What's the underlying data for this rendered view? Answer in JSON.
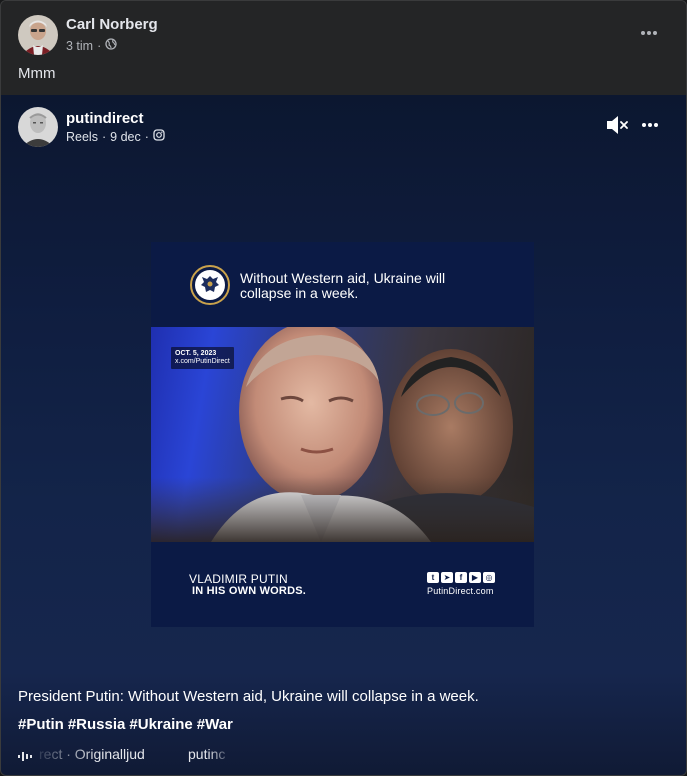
{
  "post": {
    "author": "Carl Norberg",
    "time": "3 tim",
    "separator": "·",
    "audience_icon": "globe-icon",
    "text": "Mmm"
  },
  "shared": {
    "author": "putindirect",
    "source": "Reels",
    "date": "9 dec",
    "separator": "·",
    "platform_icon": "instagram-icon",
    "mute_icon": "speaker-muted-icon"
  },
  "video": {
    "headline": "Without Western aid, Ukraine will collapse in a week.",
    "date_tag": "OCT. 5, 2023",
    "source_tag": "x.com/PutinDirect",
    "bottom_line1": "VLADIMIR PUTIN",
    "bottom_line2": "IN HIS OWN WORDS.",
    "social_icons": [
      "twitter-icon",
      "telegram-icon",
      "facebook-icon",
      "youtube-icon",
      "instagram-icon"
    ],
    "site": "PutinDirect.com",
    "brand_color": "#0b1a45"
  },
  "caption": {
    "text": "President Putin: Without Western aid, Ukraine will collapse in a week.",
    "hashtags": [
      "#Putin",
      "#Russia",
      "#Ukraine",
      "#War"
    ]
  },
  "audio": {
    "icon": "audio-waveform-icon",
    "text": "rect · Originalljud",
    "next": "putinc"
  }
}
